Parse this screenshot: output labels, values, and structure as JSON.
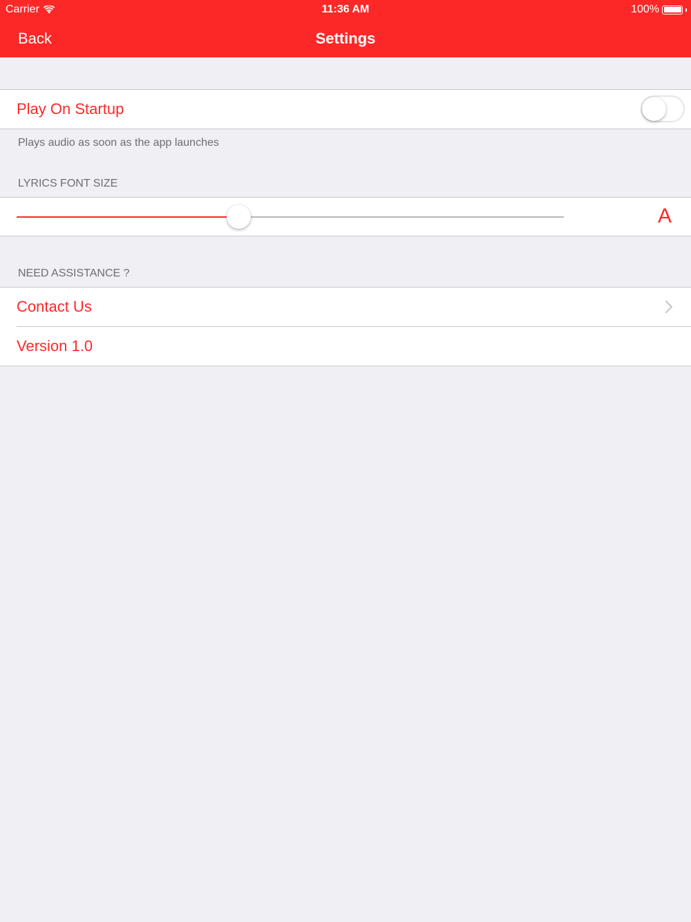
{
  "status_bar": {
    "carrier": "Carrier",
    "time": "11:36 AM",
    "battery": "100%"
  },
  "nav": {
    "back_label": "Back",
    "title": "Settings"
  },
  "play_on_startup": {
    "label": "Play On Startup",
    "enabled": false,
    "footer": "Plays audio as soon as the app launches"
  },
  "lyrics_font_size": {
    "header": "LYRICS FONT SIZE",
    "slider_value": 0.405,
    "indicator": "A"
  },
  "assistance": {
    "header": "NEED ASSISTANCE ?",
    "contact_label": "Contact Us",
    "version_label": "Version 1.0"
  },
  "colors": {
    "accent": "#fc2828",
    "background": "#efeff4",
    "secondary_text": "#6d6d72"
  },
  "icons": {
    "wifi": "wifi-icon",
    "battery": "battery-icon",
    "chevron": "chevron-right-icon"
  }
}
